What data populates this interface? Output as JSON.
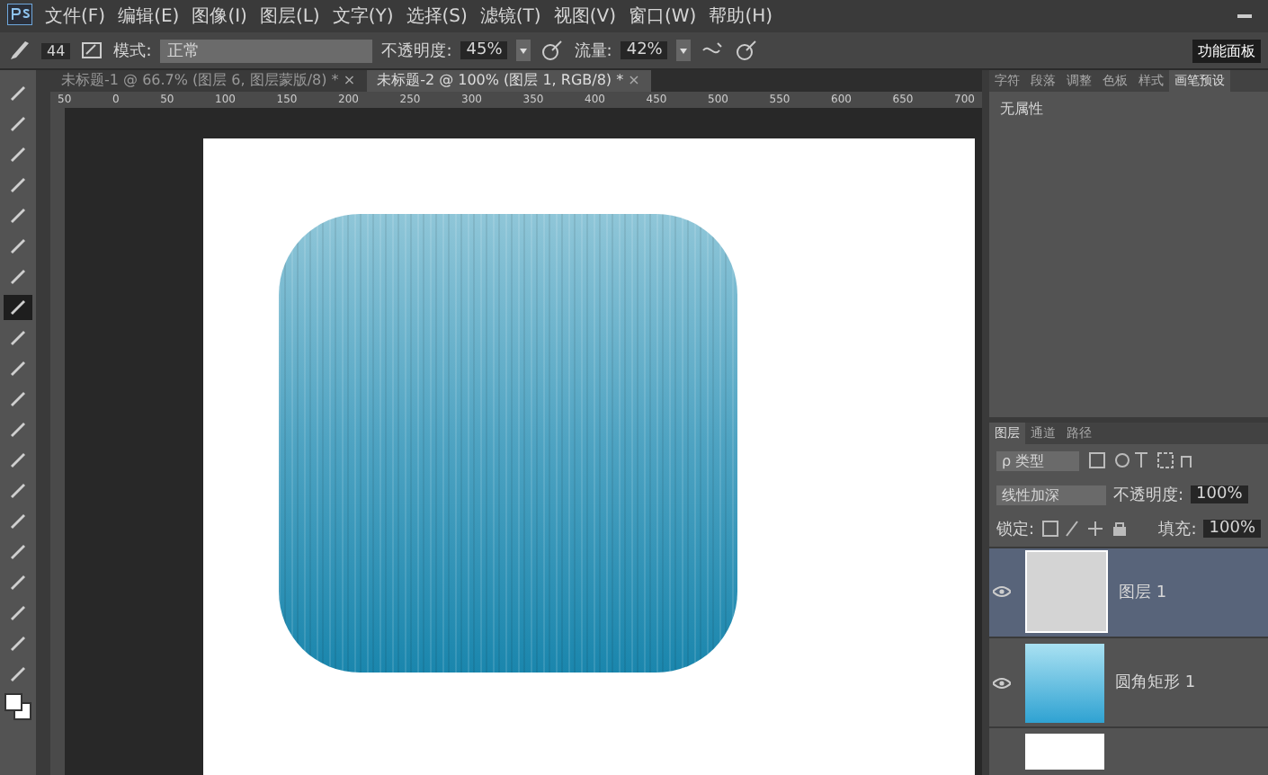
{
  "menu": [
    "文件(F)",
    "编辑(E)",
    "图像(I)",
    "图层(L)",
    "文字(Y)",
    "选择(S)",
    "滤镜(T)",
    "视图(V)",
    "窗口(W)",
    "帮助(H)"
  ],
  "options": {
    "brush_size": "44",
    "mode_label": "模式:",
    "mode": "正常",
    "opacity_label": "不透明度:",
    "opacity": "45%",
    "flow_label": "流量:",
    "flow": "42%",
    "workspace": "功能面板"
  },
  "doc_tabs": [
    {
      "label": "未标题-1 @ 66.7% (图层 6, 图层蒙版/8) *",
      "close": "×",
      "selected": false
    },
    {
      "label": "未标题-2 @ 100% (图层 1, RGB/8) *",
      "close": "×",
      "selected": true
    }
  ],
  "ruler": [
    "50",
    "0",
    "50",
    "100",
    "150",
    "200",
    "250",
    "300",
    "350",
    "400",
    "450",
    "500",
    "550",
    "600",
    "650",
    "700"
  ],
  "tools": [
    {
      "selected": false
    },
    {
      "selected": false
    },
    {
      "selected": false
    },
    {
      "selected": false
    },
    {
      "selected": false
    },
    {
      "selected": false
    },
    {
      "selected": false
    },
    {
      "selected": true
    },
    {
      "selected": false
    },
    {
      "selected": false
    },
    {
      "selected": false
    },
    {
      "selected": false
    },
    {
      "selected": false
    },
    {
      "selected": false
    },
    {
      "selected": false
    },
    {
      "selected": false
    },
    {
      "selected": false
    },
    {
      "selected": false
    },
    {
      "selected": false
    },
    {
      "selected": false
    }
  ],
  "properties_panel": {
    "tabs": [
      {
        "label": "字符",
        "selected": false
      },
      {
        "label": "段落",
        "selected": false
      },
      {
        "label": "调整",
        "selected": false
      },
      {
        "label": "色板",
        "selected": false
      },
      {
        "label": "样式",
        "selected": false
      },
      {
        "label": "画笔预设",
        "selected": true
      }
    ],
    "message": "无属性"
  },
  "layers_panel": {
    "tabs": [
      {
        "label": "图层",
        "selected": true
      },
      {
        "label": "通道",
        "selected": false
      },
      {
        "label": "路径",
        "selected": false
      }
    ],
    "filter": "ρ 类型",
    "blend_mode": "线性加深",
    "opacity_label": "不透明度:",
    "opacity": "100%",
    "lock_label": "锁定:",
    "fill_label": "填充:",
    "fill": "100%",
    "layers": [
      {
        "name": "图层 1",
        "kind": "texture",
        "visible": true,
        "selected": true
      },
      {
        "name": "圆角矩形 1",
        "kind": "gradient",
        "visible": true,
        "selected": false
      },
      {
        "kind": "white",
        "selected": false
      }
    ]
  }
}
